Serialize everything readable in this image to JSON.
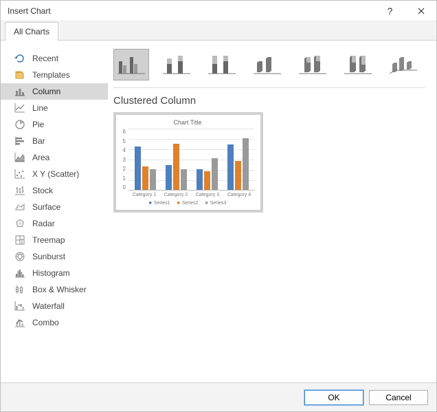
{
  "window": {
    "title": "Insert Chart"
  },
  "tabs": {
    "all_charts": "All Charts"
  },
  "sidebar": {
    "items": [
      {
        "label": "Recent",
        "icon": "recent"
      },
      {
        "label": "Templates",
        "icon": "templates"
      },
      {
        "label": "Column",
        "icon": "column"
      },
      {
        "label": "Line",
        "icon": "line"
      },
      {
        "label": "Pie",
        "icon": "pie"
      },
      {
        "label": "Bar",
        "icon": "bar"
      },
      {
        "label": "Area",
        "icon": "area"
      },
      {
        "label": "X Y (Scatter)",
        "icon": "scatter"
      },
      {
        "label": "Stock",
        "icon": "stock"
      },
      {
        "label": "Surface",
        "icon": "surface"
      },
      {
        "label": "Radar",
        "icon": "radar"
      },
      {
        "label": "Treemap",
        "icon": "treemap"
      },
      {
        "label": "Sunburst",
        "icon": "sunburst"
      },
      {
        "label": "Histogram",
        "icon": "histogram"
      },
      {
        "label": "Box & Whisker",
        "icon": "boxwhisker"
      },
      {
        "label": "Waterfall",
        "icon": "waterfall"
      },
      {
        "label": "Combo",
        "icon": "combo"
      }
    ],
    "selected_index": 2
  },
  "column_subtypes": [
    {
      "name": "clustered-column",
      "selected": true
    },
    {
      "name": "stacked-column",
      "selected": false
    },
    {
      "name": "stacked-column-100",
      "selected": false
    },
    {
      "name": "clustered-column-3d",
      "selected": false
    },
    {
      "name": "stacked-column-3d",
      "selected": false
    },
    {
      "name": "stacked-column-100-3d",
      "selected": false
    },
    {
      "name": "column-3d",
      "selected": false
    }
  ],
  "variant_title": "Clustered Column",
  "preview": {
    "title": "Chart Title",
    "yticks": [
      "6",
      "5",
      "4",
      "3",
      "2",
      "1",
      "0"
    ],
    "legend": {
      "s1": "Series1",
      "s2": "Series2",
      "s3": "Series3"
    }
  },
  "footer": {
    "ok": "OK",
    "cancel": "Cancel"
  },
  "colors": {
    "series1": "#4e7fbf",
    "series2": "#e0812c",
    "series3": "#9a9a9a"
  },
  "chart_data": {
    "type": "bar",
    "title": "Chart Title",
    "categories": [
      "Category 1",
      "Category 2",
      "Category 3",
      "Category 4"
    ],
    "series": [
      {
        "name": "Series1",
        "values": [
          4.2,
          2.4,
          2.0,
          4.4
        ]
      },
      {
        "name": "Series2",
        "values": [
          2.3,
          4.5,
          1.8,
          2.8
        ]
      },
      {
        "name": "Series3",
        "values": [
          2.0,
          2.0,
          3.1,
          5.0
        ]
      }
    ],
    "xlabel": "",
    "ylabel": "",
    "ylim": [
      0,
      6
    ],
    "legend_position": "bottom",
    "grid": true
  }
}
